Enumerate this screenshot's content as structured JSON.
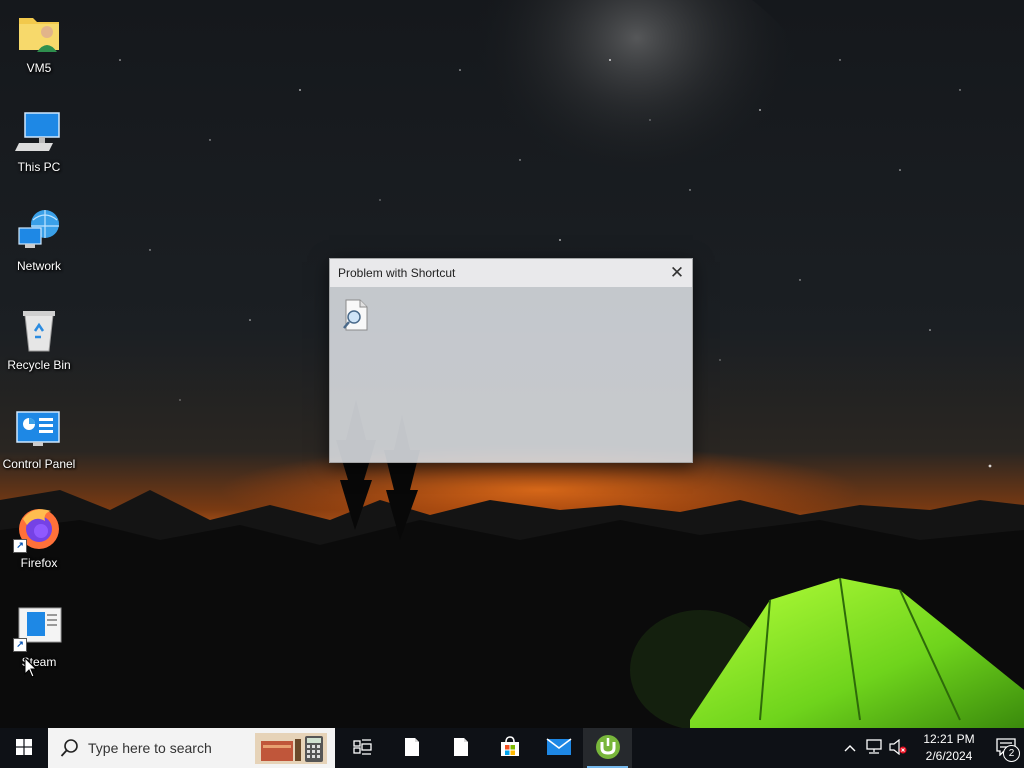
{
  "desktop": {
    "icons": [
      {
        "label": "VM5",
        "icon": "user-folder-icon"
      },
      {
        "label": "This PC",
        "icon": "computer-icon"
      },
      {
        "label": "Network",
        "icon": "network-icon"
      },
      {
        "label": "Recycle Bin",
        "icon": "recycle-bin-icon"
      },
      {
        "label": "Control Panel",
        "icon": "control-panel-icon"
      },
      {
        "label": "Firefox",
        "icon": "firefox-icon"
      },
      {
        "label": "Steam",
        "icon": "steam-shortcut-icon"
      }
    ]
  },
  "dialog": {
    "title": "Problem with Shortcut",
    "close_label": "✕",
    "icon": "search-document-icon"
  },
  "taskbar": {
    "search_placeholder": "Type here to search",
    "pinned": [
      {
        "name": "task-view",
        "icon": "task-view-icon"
      },
      {
        "name": "file-1",
        "icon": "blank-document-icon"
      },
      {
        "name": "file-2",
        "icon": "blank-document-icon"
      },
      {
        "name": "store",
        "icon": "store-icon"
      },
      {
        "name": "mail",
        "icon": "mail-icon"
      },
      {
        "name": "utorrent",
        "icon": "utorrent-icon",
        "active": true
      }
    ],
    "tray": {
      "time": "12:21 PM",
      "date": "2/6/2024",
      "notification_count": "2"
    }
  },
  "colors": {
    "taskbar_bg": "#0e1116",
    "accent": "#76b9ed",
    "tent_green": "#7fe02a"
  }
}
